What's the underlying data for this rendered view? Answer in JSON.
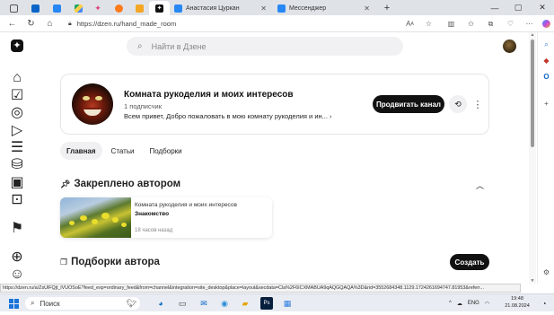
{
  "browser": {
    "tabs": [
      {
        "label": "",
        "icon": "outlook-icon"
      },
      {
        "label": "",
        "icon": "vk-icon"
      },
      {
        "label": "",
        "icon": "drive-icon"
      },
      {
        "label": "",
        "icon": "firefox-like-icon"
      },
      {
        "label": "",
        "icon": "tab-icon"
      },
      {
        "label": "",
        "icon": "dzen-icon"
      },
      {
        "label": "Анастасия Цуркан",
        "icon": "vk-icon"
      },
      {
        "label": "Мессенджер",
        "icon": "messenger-icon"
      }
    ],
    "new_tab": "+",
    "url": "https://dzen.ru/hand_made_room",
    "status_url": "https://dzen.ru/a/ZsUlFQjt_lVUOSoE?feed_exp=ordinary_feed&from=channel&integration=site_desktop&place=layout&secdata=Cla%2F6ICXMABUA9qAQGQAQA%3D&rid=3552684348.1129.1724261694747.81953&referr..."
  },
  "search": {
    "placeholder": "Найти в Дзене"
  },
  "channel": {
    "title": "Комната рукоделия и моих интересов",
    "subscribers": "1 подписчик",
    "description": "Всем привет, Добро пожаловать в мою комнату рукоделия и ин...",
    "promote_label": "Продвигать канал"
  },
  "page_tabs": [
    {
      "label": "Главная",
      "active": true
    },
    {
      "label": "Статьи",
      "active": false
    },
    {
      "label": "Подборки",
      "active": false
    }
  ],
  "pinned": {
    "title": "Закреплено автором",
    "card": {
      "channel": "Комната рукоделия и моих интересов",
      "title": "Знакомство",
      "time": "18 часов назад"
    }
  },
  "collections": {
    "title": "Подборки автора",
    "create_label": "Создать"
  },
  "taskbar": {
    "search_label": "Поиск",
    "lang": "ENG",
    "time": "19:48",
    "date": "21.08.2024"
  },
  "colors": {
    "accent_dark": "#111111",
    "chrome_bg": "#dfe3e8"
  }
}
